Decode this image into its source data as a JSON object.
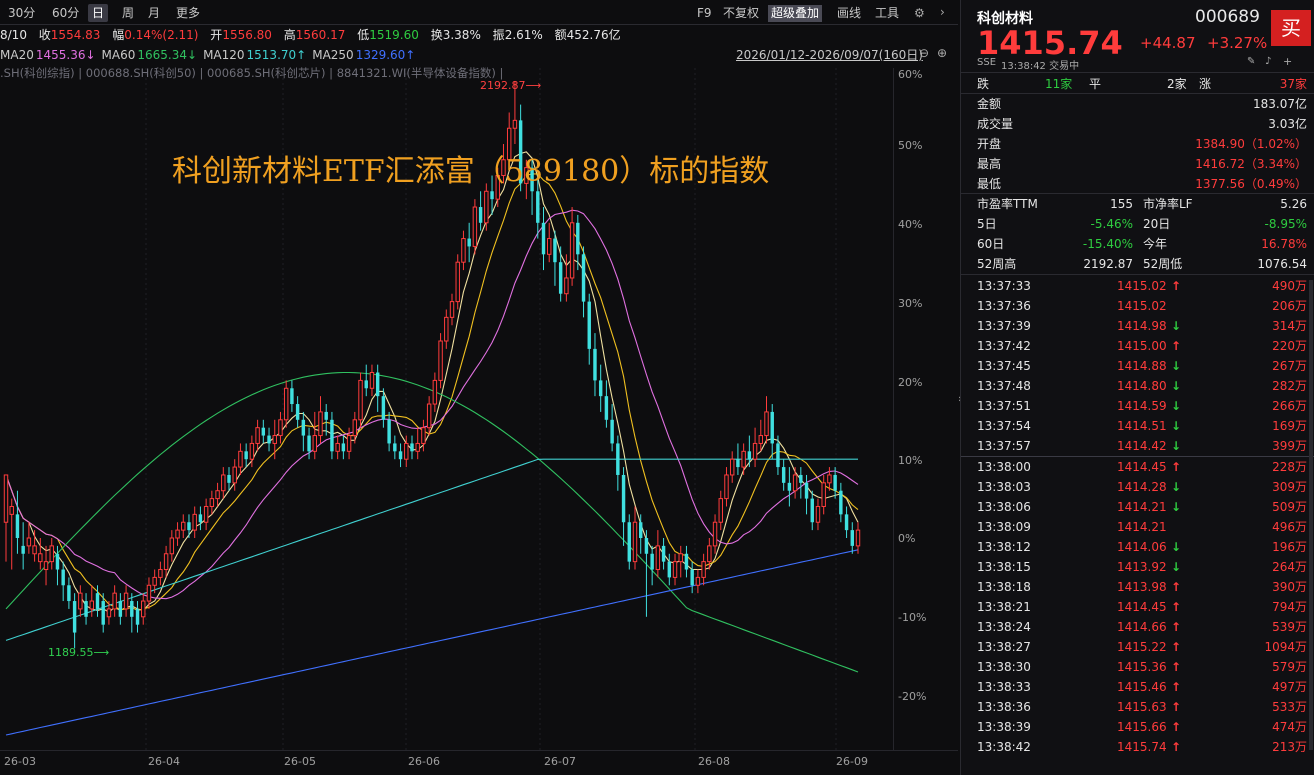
{
  "toolbar": {
    "periods": [
      "30分",
      "60分",
      "日",
      "周",
      "月",
      "更多"
    ],
    "active_period": "日",
    "right_items": [
      "F9",
      "不复权",
      "超级叠加",
      "画线",
      "工具"
    ]
  },
  "info": {
    "date": "8/10",
    "close_label": "收",
    "close": "1554.83",
    "range_label": "幅",
    "range": "0.14%(2.11)",
    "open_label": "开",
    "open": "1556.80",
    "high_label": "高",
    "high": "1560.17",
    "low_label": "低",
    "low": "1519.60",
    "turnover_label": "换",
    "turnover": "3.38%",
    "amplitude_label": "振",
    "amplitude": "2.61%",
    "amount_label": "额",
    "amount": "452.76亿"
  },
  "ma": [
    {
      "label": "MA20",
      "value": "1455.36↓",
      "color": "#e070e0"
    },
    {
      "label": "MA60",
      "value": "1665.34↓",
      "color": "#30c060"
    },
    {
      "label": "MA120",
      "value": "1513.70↑",
      "color": "#40d0d0"
    },
    {
      "label": "MA250",
      "value": "1329.60↑",
      "color": "#4070ff"
    }
  ],
  "date_range": "2026/01/12-2026/09/07(160日)",
  "overlay_text": ".SH(科创综指) | 000688.SH(科创50) | 000685.SH(科创芯片) | 8841321.WI(半导体设备指数) |",
  "headline": "科创新材料ETF汇添富（589180）标的指数",
  "max_label": "2192.87⟶",
  "min_label": "1189.55⟶",
  "axis": {
    "pct_ticks": [
      "60%",
      "50%",
      "40%",
      "30%",
      "20%",
      "10%",
      "0%",
      "-10%",
      "-20%"
    ],
    "dates": [
      "26-03",
      "26-04",
      "26-05",
      "26-06",
      "26-07",
      "26-08",
      "26-09"
    ]
  },
  "chart_data": {
    "type": "candlestick",
    "x_dates": [
      "26-03",
      "26-04",
      "26-05",
      "26-06",
      "26-07",
      "26-08",
      "26-09"
    ],
    "y_ticks_pct": [
      60,
      50,
      40,
      30,
      20,
      10,
      0,
      -10,
      -20
    ],
    "high_marker": 2192.87,
    "low_marker": 1189.55,
    "candles": [
      [
        2,
        8,
        -3,
        3
      ],
      [
        3,
        4,
        -4,
        5
      ],
      [
        3,
        0,
        -2,
        6
      ],
      [
        -1,
        -2,
        -4,
        2
      ],
      [
        -1,
        0,
        -2,
        2
      ],
      [
        -2,
        -1,
        -3,
        1
      ],
      [
        -3,
        -2,
        -4,
        0
      ],
      [
        -4,
        -3,
        -6,
        -1
      ],
      [
        -3,
        -1,
        -4,
        0
      ],
      [
        -2,
        -4,
        -6,
        -1
      ],
      [
        -4,
        -6,
        -8,
        -3
      ],
      [
        -6,
        -8,
        -9,
        -5
      ],
      [
        -8,
        -12,
        -14,
        -7
      ],
      [
        -9,
        -7,
        -10,
        -6
      ],
      [
        -8,
        -10,
        -11,
        -7
      ],
      [
        -9,
        -8,
        -10,
        -6
      ],
      [
        -7,
        -9,
        -10,
        -6
      ],
      [
        -8,
        -11,
        -12,
        -7
      ],
      [
        -10,
        -9,
        -11,
        -8
      ],
      [
        -9,
        -7,
        -10,
        -6
      ],
      [
        -8,
        -10,
        -11,
        -7
      ],
      [
        -9,
        -7,
        -10,
        -6
      ],
      [
        -8,
        -10,
        -12,
        -7
      ],
      [
        -9,
        -11,
        -12,
        -8
      ],
      [
        -10,
        -8,
        -11,
        -7
      ],
      [
        -8,
        -6,
        -9,
        -5
      ],
      [
        -6,
        -5,
        -7,
        -4
      ],
      [
        -5,
        -4,
        -6,
        -3
      ],
      [
        -4,
        -2,
        -5,
        -1
      ],
      [
        -2,
        0,
        -3,
        1
      ],
      [
        0,
        1,
        -1,
        2
      ],
      [
        1,
        2,
        0,
        3
      ],
      [
        2,
        1,
        0,
        3
      ],
      [
        1,
        3,
        0,
        4
      ],
      [
        3,
        2,
        1,
        4
      ],
      [
        2,
        4,
        1,
        5
      ],
      [
        4,
        5,
        3,
        6
      ],
      [
        5,
        6,
        4,
        7
      ],
      [
        6,
        8,
        5,
        9
      ],
      [
        8,
        7,
        6,
        9
      ],
      [
        7,
        9,
        6,
        10
      ],
      [
        9,
        11,
        8,
        12
      ],
      [
        11,
        10,
        9,
        12
      ],
      [
        10,
        12,
        9,
        13
      ],
      [
        12,
        14,
        11,
        15
      ],
      [
        14,
        13,
        12,
        15
      ],
      [
        13,
        12,
        11,
        14
      ],
      [
        12,
        13,
        10,
        15
      ],
      [
        13,
        15,
        12,
        16
      ],
      [
        15,
        19,
        14,
        20
      ],
      [
        19,
        17,
        16,
        20
      ],
      [
        17,
        15,
        14,
        18
      ],
      [
        15,
        13,
        11,
        16
      ],
      [
        13,
        11,
        10,
        14
      ],
      [
        11,
        13,
        10,
        16
      ],
      [
        13,
        16,
        12,
        18
      ],
      [
        16,
        15,
        13,
        17
      ],
      [
        15,
        11,
        10,
        16
      ],
      [
        11,
        12,
        10,
        13
      ],
      [
        12,
        11,
        10,
        13
      ],
      [
        11,
        13,
        10,
        14
      ],
      [
        13,
        15,
        12,
        16
      ],
      [
        15,
        20,
        14,
        21
      ],
      [
        20,
        19,
        18,
        22
      ],
      [
        19,
        21,
        18,
        22
      ],
      [
        21,
        18,
        16,
        22
      ],
      [
        18,
        15,
        14,
        19
      ],
      [
        15,
        12,
        11,
        16
      ],
      [
        12,
        11,
        10,
        13
      ],
      [
        11,
        10,
        9,
        12
      ],
      [
        10,
        12,
        9,
        13
      ],
      [
        12,
        11,
        10,
        13
      ],
      [
        11,
        12,
        10,
        14
      ],
      [
        12,
        14,
        11,
        15
      ],
      [
        14,
        17,
        13,
        18
      ],
      [
        17,
        20,
        16,
        21
      ],
      [
        20,
        25,
        19,
        26
      ],
      [
        25,
        28,
        24,
        29
      ],
      [
        28,
        30,
        27,
        31
      ],
      [
        30,
        35,
        29,
        36
      ],
      [
        35,
        38,
        34,
        39
      ],
      [
        38,
        37,
        35,
        40
      ],
      [
        37,
        42,
        36,
        43
      ],
      [
        42,
        40,
        39,
        44
      ],
      [
        40,
        44,
        39,
        45
      ],
      [
        44,
        43,
        41,
        46
      ],
      [
        43,
        46,
        42,
        47
      ],
      [
        46,
        48,
        45,
        50
      ],
      [
        48,
        52,
        47,
        54
      ],
      [
        52,
        53,
        50,
        58
      ],
      [
        53,
        45,
        44,
        55
      ],
      [
        45,
        47,
        43,
        48
      ],
      [
        47,
        44,
        41,
        48
      ],
      [
        44,
        40,
        38,
        46
      ],
      [
        40,
        36,
        34,
        42
      ],
      [
        36,
        38,
        35,
        40
      ],
      [
        38,
        35,
        32,
        39
      ],
      [
        35,
        31,
        30,
        37
      ],
      [
        31,
        33,
        30,
        36
      ],
      [
        33,
        40,
        32,
        42
      ],
      [
        40,
        36,
        34,
        41
      ],
      [
        36,
        30,
        28,
        37
      ],
      [
        30,
        24,
        22,
        31
      ],
      [
        24,
        20,
        18,
        26
      ],
      [
        20,
        18,
        16,
        22
      ],
      [
        18,
        15,
        14,
        20
      ],
      [
        15,
        12,
        11,
        17
      ],
      [
        12,
        8,
        6,
        13
      ],
      [
        8,
        2,
        -1,
        9
      ],
      [
        2,
        -3,
        -4,
        3
      ],
      [
        -3,
        2,
        -4,
        4
      ],
      [
        2,
        0,
        -2,
        3
      ],
      [
        0,
        -2,
        -10,
        1
      ],
      [
        -2,
        -4,
        -6,
        -1
      ],
      [
        -4,
        -1,
        -5,
        1
      ],
      [
        -1,
        -3,
        -4,
        0
      ],
      [
        -3,
        -5,
        -6,
        -2
      ],
      [
        -5,
        -3,
        -6,
        -2
      ],
      [
        -3,
        -2,
        -5,
        -1
      ],
      [
        -2,
        -4,
        -5,
        -1
      ],
      [
        -4,
        -6,
        -7,
        -3
      ],
      [
        -6,
        -5,
        -7,
        -4
      ],
      [
        -5,
        -3,
        -6,
        -2
      ],
      [
        -3,
        -1,
        -4,
        0
      ],
      [
        -1,
        2,
        -2,
        3
      ],
      [
        2,
        5,
        1,
        6
      ],
      [
        5,
        8,
        4,
        9
      ],
      [
        8,
        10,
        7,
        11
      ],
      [
        10,
        9,
        8,
        12
      ],
      [
        9,
        11,
        8,
        12
      ],
      [
        11,
        10,
        9,
        13
      ],
      [
        10,
        12,
        9,
        14
      ],
      [
        12,
        13,
        11,
        15
      ],
      [
        13,
        16,
        12,
        18
      ],
      [
        16,
        12,
        10,
        17
      ],
      [
        12,
        9,
        8,
        13
      ],
      [
        9,
        7,
        6,
        10
      ],
      [
        7,
        6,
        4,
        9
      ],
      [
        6,
        8,
        5,
        9
      ],
      [
        8,
        7,
        5,
        9
      ],
      [
        7,
        5,
        3,
        8
      ],
      [
        5,
        2,
        1,
        6
      ],
      [
        2,
        4,
        1,
        5
      ],
      [
        4,
        7,
        3,
        8
      ],
      [
        7,
        8,
        6,
        9
      ],
      [
        8,
        6,
        5,
        9
      ],
      [
        6,
        3,
        2,
        7
      ],
      [
        3,
        1,
        0,
        4
      ],
      [
        1,
        -1,
        -2,
        2
      ],
      [
        -1,
        1,
        -2,
        2
      ]
    ],
    "ma_lines": [
      {
        "name": "MA5",
        "color": "#f0e0a0"
      },
      {
        "name": "MA10",
        "color": "#f0c020"
      },
      {
        "name": "MA20",
        "color": "#e070e0"
      },
      {
        "name": "MA60",
        "color": "#30c060"
      },
      {
        "name": "MA120",
        "color": "#40d0d0"
      },
      {
        "name": "MA250",
        "color": "#4070ff"
      }
    ]
  },
  "quote": {
    "name": "科创材料",
    "code": "000689",
    "buy_label": "买",
    "price": "1415.74",
    "change": "+44.87",
    "change_pct": "+3.27%",
    "exchange": "SSE",
    "time_status": "13:38:42 交易中",
    "breadth": {
      "down_label": "跌",
      "down": "11家",
      "flat_label": "平",
      "flat": "2家",
      "up_label": "涨",
      "up": "37家"
    },
    "stats": [
      {
        "label": "金额",
        "value": "183.07亿",
        "color": "white"
      },
      {
        "label": "成交量",
        "value": "3.03亿",
        "color": "white"
      },
      {
        "label": "开盘",
        "value": "1384.90（1.02%）",
        "color": "red"
      },
      {
        "label": "最高",
        "value": "1416.72（3.34%）",
        "color": "red"
      },
      {
        "label": "最低",
        "value": "1377.56（0.49%）",
        "color": "red"
      }
    ],
    "valuation": [
      {
        "l1": "市盈率TTM",
        "v1": "155",
        "c1": "white",
        "l2": "市净率LF",
        "v2": "5.26",
        "c2": "white"
      },
      {
        "l1": "5日",
        "v1": "-5.46%",
        "c1": "green",
        "l2": "20日",
        "v2": "-8.95%",
        "c2": "green"
      },
      {
        "l1": "60日",
        "v1": "-15.40%",
        "c1": "green",
        "l2": "今年",
        "v2": "16.78%",
        "c2": "red"
      },
      {
        "l1": "52周高",
        "v1": "2192.87",
        "c1": "white",
        "l2": "52周低",
        "v2": "1076.54",
        "c2": "white"
      }
    ],
    "ticks_a": [
      {
        "t": "13:37:33",
        "p": "1415.02",
        "a": "up",
        "v": "490万"
      },
      {
        "t": "13:37:36",
        "p": "1415.02",
        "a": "",
        "v": "206万"
      },
      {
        "t": "13:37:39",
        "p": "1414.98",
        "a": "down",
        "v": "314万"
      },
      {
        "t": "13:37:42",
        "p": "1415.00",
        "a": "up",
        "v": "220万"
      },
      {
        "t": "13:37:45",
        "p": "1414.88",
        "a": "down",
        "v": "267万"
      },
      {
        "t": "13:37:48",
        "p": "1414.80",
        "a": "down",
        "v": "282万"
      },
      {
        "t": "13:37:51",
        "p": "1414.59",
        "a": "down",
        "v": "266万"
      },
      {
        "t": "13:37:54",
        "p": "1414.51",
        "a": "down",
        "v": "169万"
      },
      {
        "t": "13:37:57",
        "p": "1414.42",
        "a": "down",
        "v": "399万"
      }
    ],
    "ticks_b": [
      {
        "t": "13:38:00",
        "p": "1414.45",
        "a": "up",
        "v": "228万"
      },
      {
        "t": "13:38:03",
        "p": "1414.28",
        "a": "down",
        "v": "309万"
      },
      {
        "t": "13:38:06",
        "p": "1414.21",
        "a": "down",
        "v": "509万"
      },
      {
        "t": "13:38:09",
        "p": "1414.21",
        "a": "",
        "v": "496万"
      },
      {
        "t": "13:38:12",
        "p": "1414.06",
        "a": "down",
        "v": "196万"
      },
      {
        "t": "13:38:15",
        "p": "1413.92",
        "a": "down",
        "v": "264万"
      },
      {
        "t": "13:38:18",
        "p": "1413.98",
        "a": "up",
        "v": "390万"
      },
      {
        "t": "13:38:21",
        "p": "1414.45",
        "a": "up",
        "v": "794万"
      },
      {
        "t": "13:38:24",
        "p": "1414.66",
        "a": "up",
        "v": "539万"
      },
      {
        "t": "13:38:27",
        "p": "1415.22",
        "a": "up",
        "v": "1094万"
      },
      {
        "t": "13:38:30",
        "p": "1415.36",
        "a": "up",
        "v": "579万"
      },
      {
        "t": "13:38:33",
        "p": "1415.46",
        "a": "up",
        "v": "497万"
      },
      {
        "t": "13:38:36",
        "p": "1415.63",
        "a": "up",
        "v": "533万"
      },
      {
        "t": "13:38:39",
        "p": "1415.66",
        "a": "up",
        "v": "474万"
      },
      {
        "t": "13:38:42",
        "p": "1415.74",
        "a": "up",
        "v": "213万"
      }
    ]
  }
}
